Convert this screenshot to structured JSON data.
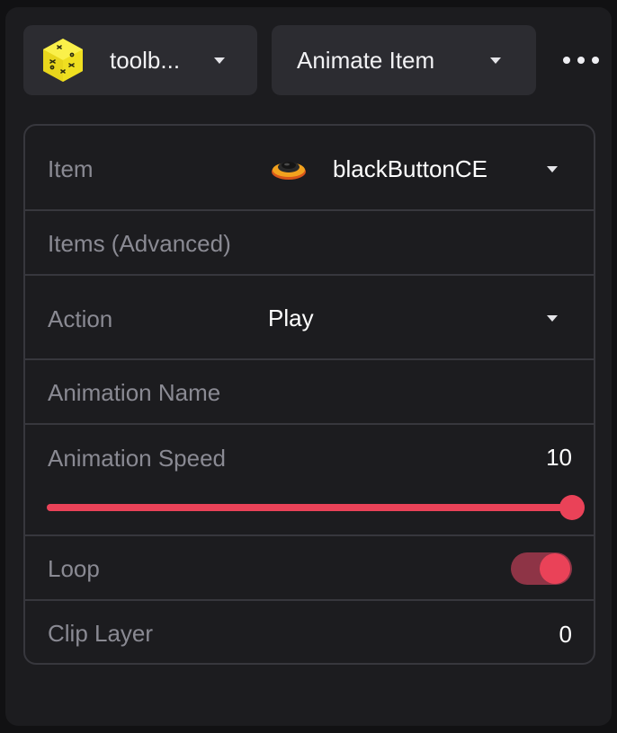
{
  "header": {
    "object_dropdown": {
      "label": "toolb...",
      "icon": "yellow-cube-icon"
    },
    "action_dropdown": {
      "label": "Animate Item"
    },
    "more_menu": {
      "icon": "more-horizontal-icon"
    }
  },
  "properties": {
    "item": {
      "label": "Item",
      "value": "blackButtonCE",
      "icon": "black-button-thumbnail-icon"
    },
    "items_advanced": {
      "label": "Items (Advanced)"
    },
    "action": {
      "label": "Action",
      "value": "Play"
    },
    "animation_name": {
      "label": "Animation Name"
    },
    "animation_speed": {
      "label": "Animation Speed",
      "value": "10",
      "slider_fraction": 1.0
    },
    "loop": {
      "label": "Loop",
      "enabled": true
    },
    "clip_layer": {
      "label": "Clip Layer",
      "value": "0"
    }
  },
  "colors": {
    "accent": "#ea4258",
    "toggle_track": "#8e3446",
    "panel_bg": "#1c1c1f",
    "dropdown_bg": "#2c2c31",
    "label_text": "#8a8a93",
    "value_text": "#ffffff"
  }
}
